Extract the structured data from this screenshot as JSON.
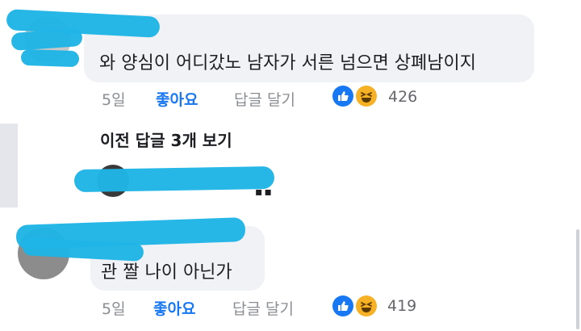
{
  "comment1": {
    "author": "",
    "text": "와 양심이 어디갔노 남자가 서른 넘으면 상폐남이지",
    "time": "5일",
    "like_label": "좋아요",
    "reply_label": "답글 달기",
    "reaction_count": "426"
  },
  "thread": {
    "prev_replies_label": "이전 답글 3개 보기"
  },
  "comment2": {
    "author": "",
    "text": "관 짤 나이 아닌가",
    "time": "5일",
    "like_label": "좋아요",
    "reply_label": "답글 달기",
    "reaction_count": "419"
  },
  "colors": {
    "like_blue": "#1877f2",
    "haha_yellow": "#f7b125",
    "bubble_bg": "#f0f2f5",
    "redaction_cyan": "#1fb5e6"
  },
  "icons": [
    "like-reaction-icon",
    "haha-reaction-icon"
  ]
}
